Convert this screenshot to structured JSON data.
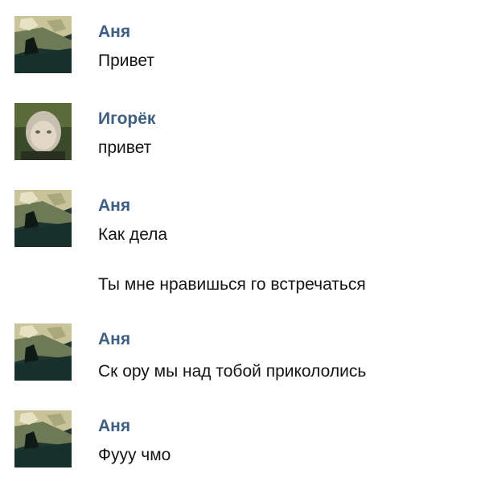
{
  "colors": {
    "author": "#3e5e82",
    "text": "#141414",
    "background": "#ffffff"
  },
  "messages": [
    {
      "author": "Аня",
      "avatar": "anya-avatar",
      "text": "Привет"
    },
    {
      "author": "Игорёк",
      "avatar": "igorek-avatar",
      "text": "привет"
    },
    {
      "author": "Аня",
      "avatar": "anya-avatar",
      "text": "Как дела",
      "followup": "Ты мне нравишься го встречаться"
    },
    {
      "author": "Аня",
      "avatar": "anya-avatar",
      "text": "Ск ору мы над тобой прикололись"
    },
    {
      "author": "Аня",
      "avatar": "anya-avatar",
      "text": "Фууу чмо"
    }
  ]
}
